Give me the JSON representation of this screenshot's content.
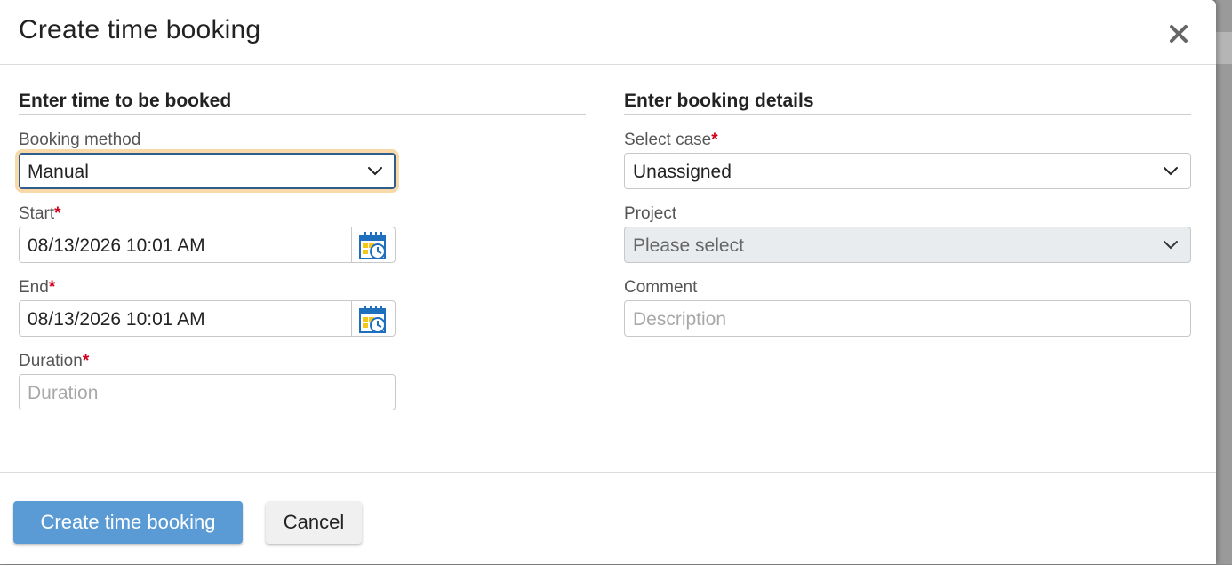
{
  "dialog": {
    "title": "Create time booking"
  },
  "left_section": {
    "title": "Enter time to be booked",
    "booking_method": {
      "label": "Booking method",
      "value": "Manual"
    },
    "start": {
      "label": "Start",
      "required_mark": "*",
      "value": "08/13/2026 10:01 AM",
      "button_icon": "calendar-clock-icon"
    },
    "end": {
      "label": "End",
      "required_mark": "*",
      "value": "08/13/2026 10:01 AM",
      "button_icon": "calendar-clock-icon"
    },
    "duration": {
      "label": "Duration",
      "required_mark": "*",
      "value": "",
      "placeholder": "Duration"
    }
  },
  "right_section": {
    "title": "Enter booking details",
    "select_case": {
      "label": "Select case",
      "required_mark": "*",
      "value": "Unassigned"
    },
    "project": {
      "label": "Project",
      "value": "Please select",
      "disabled": true
    },
    "comment": {
      "label": "Comment",
      "value": "",
      "placeholder": "Description"
    }
  },
  "footer": {
    "primary_label": "Create time booking",
    "cancel_label": "Cancel"
  },
  "colors": {
    "primary_button": "#5b9bd5",
    "required_mark": "#d0021b",
    "focus_ring": "#f9d9a8",
    "focus_border": "#2f5e8c",
    "calendar_icon_blue": "#1f6fbf",
    "calendar_icon_yellow": "#f5c518"
  }
}
